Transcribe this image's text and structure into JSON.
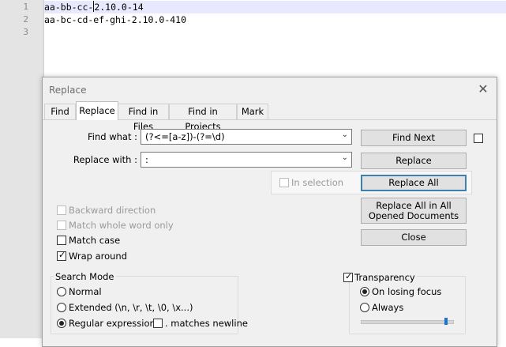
{
  "editor": {
    "lines": [
      {
        "number": "1",
        "before_caret": "aa-bb-cc-",
        "after_caret": "2.10.0-14"
      },
      {
        "number": "2",
        "text": "aa-bc-cd-ef-ghi-2.10.0-410"
      },
      {
        "number": "3",
        "text": ""
      }
    ]
  },
  "dialog": {
    "title": "Replace",
    "tabs": [
      "Find",
      "Replace",
      "Find in Files",
      "Find in Projects",
      "Mark"
    ],
    "active_tab": "Replace",
    "find_what_label": "Find what :",
    "find_what_value": "(?<=[a-z])-(?=\\d)",
    "replace_with_label": "Replace with :",
    "replace_with_value": ":",
    "in_selection_label": "In selection",
    "buttons": {
      "find_next": "Find Next",
      "replace": "Replace",
      "replace_all": "Replace All",
      "replace_all_opened": "Replace All in All Opened Documents",
      "close": "Close"
    },
    "options": {
      "backward_direction": "Backward direction",
      "match_whole_word": "Match whole word only",
      "match_case": "Match case",
      "wrap_around": "Wrap around"
    },
    "search_mode": {
      "title": "Search Mode",
      "normal": "Normal",
      "extended": "Extended (\\n, \\r, \\t, \\0, \\x...)",
      "regex": "Regular expression",
      "matches_newline": ". matches newline"
    },
    "transparency": {
      "label": "Transparency",
      "on_losing_focus": "On losing focus",
      "always": "Always",
      "level_percent": 95
    },
    "colors": {
      "focus_border": "#3c7fb1",
      "slider_thumb": "#1e74d1",
      "current_line": "#e8e8ff"
    }
  }
}
